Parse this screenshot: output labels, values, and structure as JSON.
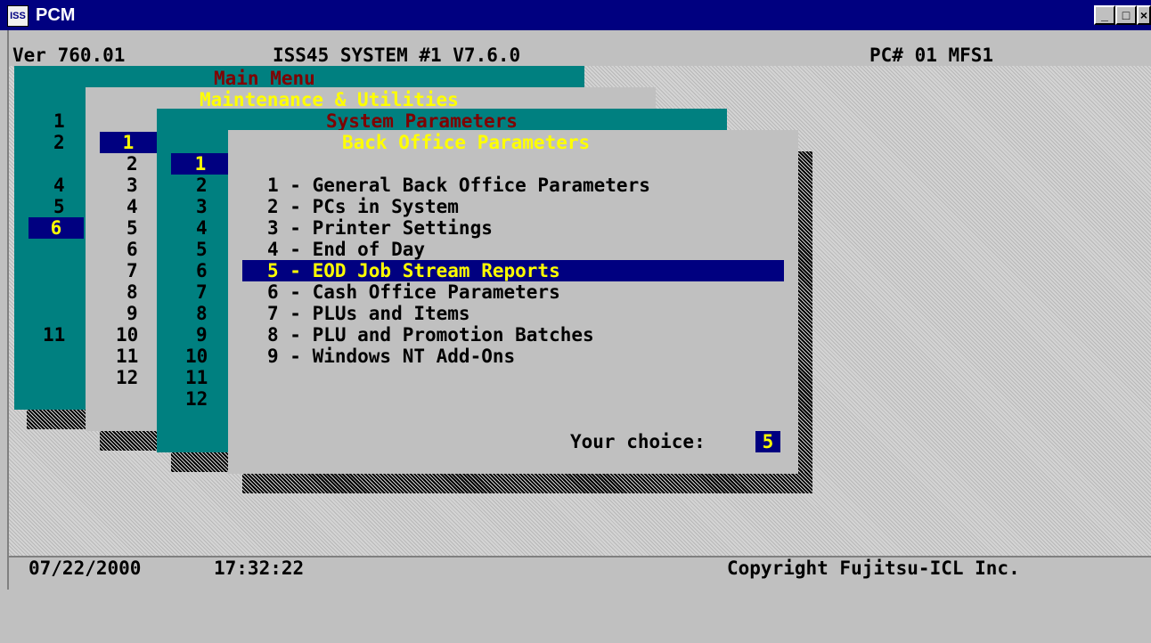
{
  "window": {
    "title": "PCM",
    "icon": "iss-app-icon",
    "icon_label": "ISS",
    "controls": {
      "minimize": "_",
      "maximize": "□",
      "close": "×"
    }
  },
  "header": {
    "version": "Ver 760.01",
    "system": "ISS45 SYSTEM #1 V7.6.0",
    "pc": "PC# 01 MFS1"
  },
  "main_menu": {
    "title": "Main Menu",
    "numbers": [
      "1",
      "2",
      "4",
      "5",
      "6",
      "11"
    ],
    "selected": "6"
  },
  "maintenance_menu": {
    "title": "Maintenance & Utilities",
    "numbers": [
      "1",
      "2",
      "3",
      "4",
      "5",
      "6",
      "7",
      "8",
      "9",
      "10",
      "11",
      "12"
    ],
    "selected": "1"
  },
  "system_params_menu": {
    "title": "System Parameters",
    "numbers": [
      "1",
      "2",
      "3",
      "4",
      "5",
      "6",
      "7",
      "8",
      "9",
      "10",
      "11",
      "12"
    ],
    "selected": "1"
  },
  "back_office_menu": {
    "title": "Back Office Parameters",
    "items": [
      "1 - General Back Office Parameters",
      "2 - PCs in System",
      "3 - Printer Settings",
      "4 - End of Day",
      "5 - EOD Job Stream Reports",
      "6 - Cash Office Parameters",
      "7 - PLUs and Items",
      "8 - PLU and Promotion Batches",
      "9 - Windows NT Add-Ons"
    ],
    "selected_index": 4,
    "choice_label": "Your choice:",
    "choice_value": "5"
  },
  "footer": {
    "date": "07/22/2000",
    "time": "17:32:22",
    "copyright": "Copyright Fujitsu-ICL Inc."
  },
  "colors": {
    "titlebar": "#000080",
    "teal": "#008080",
    "panel_grey": "#c0c0c0",
    "highlight_bg": "#000080",
    "highlight_fg": "#ffff00",
    "title_red": "#800000"
  }
}
